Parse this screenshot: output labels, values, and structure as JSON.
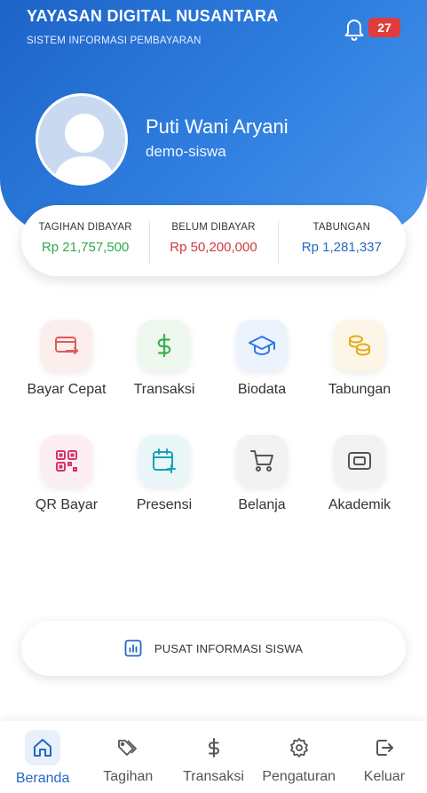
{
  "header": {
    "org_name": "YAYASAN DIGITAL NUSANTARA",
    "org_subtitle": "SISTEM INFORMASI PEMBAYARAN",
    "notification_count": "27"
  },
  "profile": {
    "name": "Puti Wani Aryani",
    "username": "demo-siswa"
  },
  "summary": [
    {
      "label": "TAGIHAN DIBAYAR",
      "value": "Rp 21,757,500",
      "color": "#2eaa4a"
    },
    {
      "label": "BELUM DIBAYAR",
      "value": "Rp 50,200,000",
      "color": "#d0393b"
    },
    {
      "label": "TABUNGAN",
      "value": "Rp 1,281,337",
      "color": "#2468c6"
    }
  ],
  "menu": [
    {
      "label": "Bayar Cepat",
      "icon": "card-transfer-icon",
      "color": "#e05a5a",
      "bg": "#fdeeee"
    },
    {
      "label": "Transaksi",
      "icon": "dollar-icon",
      "color": "#3bb04f",
      "bg": "#eef8ef"
    },
    {
      "label": "Biodata",
      "icon": "graduation-cap-icon",
      "color": "#2c7be5",
      "bg": "#ecf3fd"
    },
    {
      "label": "Tabungan",
      "icon": "coins-icon",
      "color": "#e6a91c",
      "bg": "#fdf6e6"
    },
    {
      "label": "QR Bayar",
      "icon": "qr-code-icon",
      "color": "#d6336c",
      "bg": "#fdeef3"
    },
    {
      "label": "Presensi",
      "icon": "calendar-plus-icon",
      "color": "#17a2b8",
      "bg": "#eaf7f9"
    },
    {
      "label": "Belanja",
      "icon": "cart-icon",
      "color": "#555555",
      "bg": "#f2f2f3"
    },
    {
      "label": "Akademik",
      "icon": "tablet-icon",
      "color": "#555555",
      "bg": "#f2f2f3"
    }
  ],
  "info_bar": {
    "label": "PUSAT INFORMASI SISWA",
    "icon": "bar-chart-icon",
    "color": "#2468c6"
  },
  "bottom_nav": [
    {
      "label": "Beranda",
      "icon": "home-icon",
      "active": true
    },
    {
      "label": "Tagihan",
      "icon": "tags-icon",
      "active": false
    },
    {
      "label": "Transaksi",
      "icon": "dollar-icon",
      "active": false
    },
    {
      "label": "Pengaturan",
      "icon": "gear-icon",
      "active": false
    },
    {
      "label": "Keluar",
      "icon": "logout-icon",
      "active": false
    }
  ]
}
